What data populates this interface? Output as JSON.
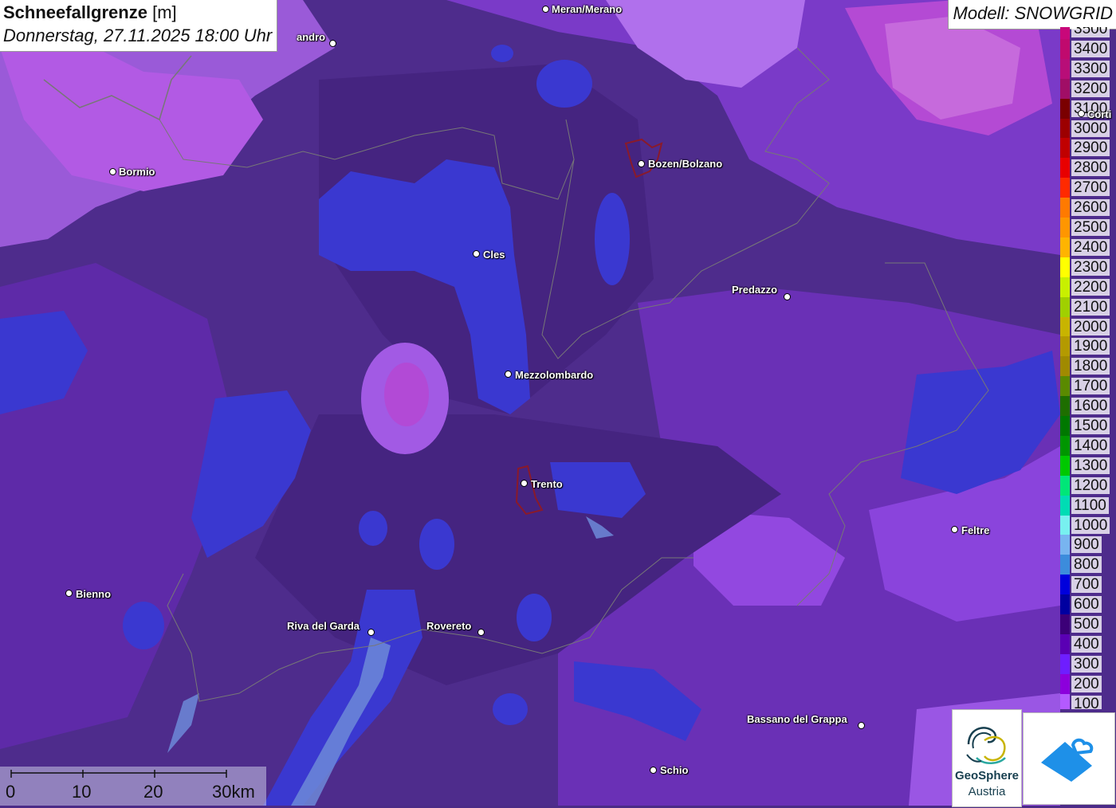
{
  "header": {
    "title_bold": "Schneefallgrenze",
    "title_unit": "[m]",
    "datetime": "Donnerstag, 27.11.2025 18:00 Uhr",
    "model": "Modell: SNOWGRID"
  },
  "legend": {
    "items": [
      {
        "label": "3500",
        "color": "#c8087a"
      },
      {
        "label": "3400",
        "color": "#c00a6e"
      },
      {
        "label": "3300",
        "color": "#b80e78"
      },
      {
        "label": "3200",
        "color": "#a00e66"
      },
      {
        "label": "3100",
        "color": "#7a0000"
      },
      {
        "label": "3000",
        "color": "#9c0000"
      },
      {
        "label": "2900",
        "color": "#c00000"
      },
      {
        "label": "2800",
        "color": "#e80000"
      },
      {
        "label": "2700",
        "color": "#ff2a00"
      },
      {
        "label": "2600",
        "color": "#ff7a00"
      },
      {
        "label": "2500",
        "color": "#ff9600"
      },
      {
        "label": "2400",
        "color": "#ffb400"
      },
      {
        "label": "2300",
        "color": "#ffff00"
      },
      {
        "label": "2200",
        "color": "#c8f000"
      },
      {
        "label": "2100",
        "color": "#a0d000"
      },
      {
        "label": "2000",
        "color": "#c8b400"
      },
      {
        "label": "1900",
        "color": "#b49a00"
      },
      {
        "label": "1800",
        "color": "#a08a00"
      },
      {
        "label": "1700",
        "color": "#5a8a00"
      },
      {
        "label": "1600",
        "color": "#1e6e00"
      },
      {
        "label": "1500",
        "color": "#007800"
      },
      {
        "label": "1400",
        "color": "#009600"
      },
      {
        "label": "1300",
        "color": "#00c800"
      },
      {
        "label": "1200",
        "color": "#00e678"
      },
      {
        "label": "1100",
        "color": "#00dcb4"
      },
      {
        "label": "1000",
        "color": "#78f0f0"
      },
      {
        "label": "900",
        "color": "#78b4f0"
      },
      {
        "label": "800",
        "color": "#3c8cdc"
      },
      {
        "label": "700",
        "color": "#0000dc"
      },
      {
        "label": "600",
        "color": "#0000a0"
      },
      {
        "label": "500",
        "color": "#3c0078"
      },
      {
        "label": "400",
        "color": "#5a00b4"
      },
      {
        "label": "300",
        "color": "#6e1eff"
      },
      {
        "label": "200",
        "color": "#8c00dc"
      },
      {
        "label": "100",
        "color": "#b45aff"
      }
    ]
  },
  "cities": [
    {
      "name": "Meran/Merano"
    },
    {
      "name": "andro"
    },
    {
      "name": "Bormio"
    },
    {
      "name": "Bozen/Bolzano"
    },
    {
      "name": "Cles"
    },
    {
      "name": "Predazzo"
    },
    {
      "name": "Corti"
    },
    {
      "name": "Mezzolombardo"
    },
    {
      "name": "Trento"
    },
    {
      "name": "Feltre"
    },
    {
      "name": "Bienno"
    },
    {
      "name": "Riva del Garda"
    },
    {
      "name": "Rovereto"
    },
    {
      "name": "Bassano del Grappa"
    },
    {
      "name": "Schio"
    }
  ],
  "scale": {
    "labels": [
      "0",
      "10",
      "20",
      "30km"
    ]
  },
  "logos": {
    "geosphere_line1": "GeoSphere",
    "geosphere_line2": "Austria"
  }
}
